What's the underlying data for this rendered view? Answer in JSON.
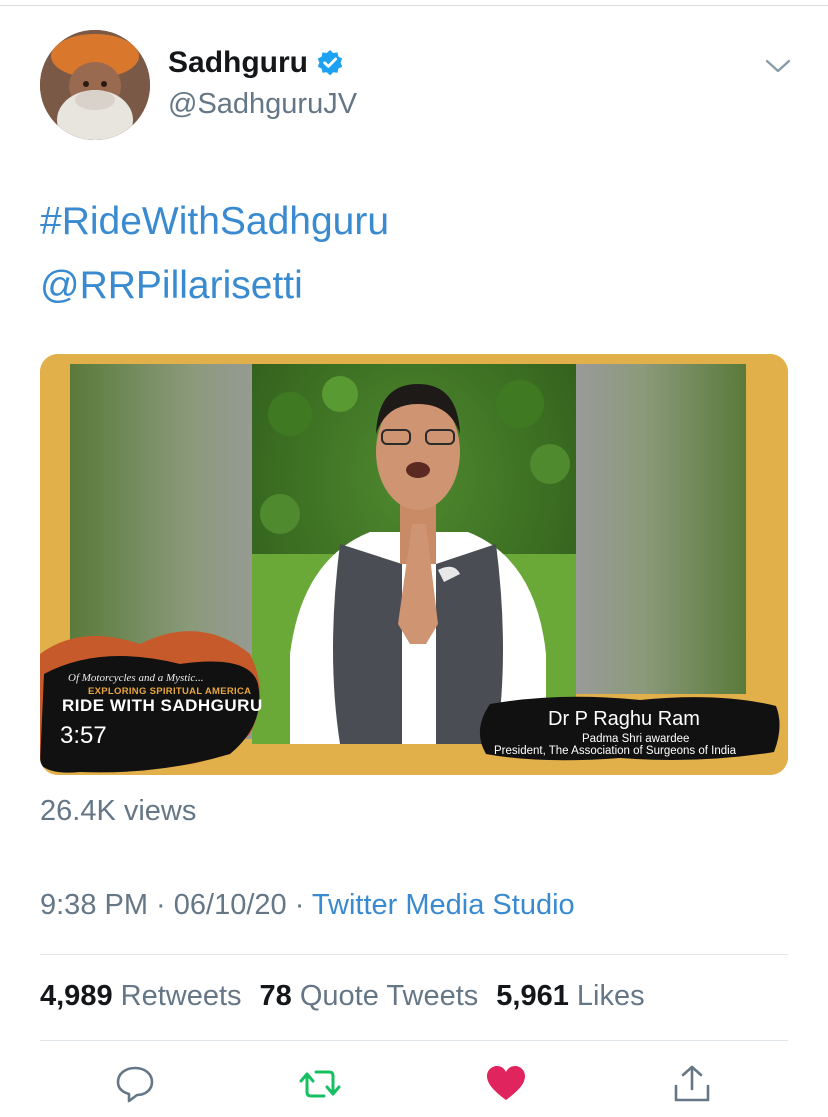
{
  "tweet": {
    "author": {
      "display_name": "Sadhguru",
      "handle": "@SadhguruJV",
      "verified": true
    },
    "text_lines": [
      "#RideWithSadhguru",
      "@RRPillarisetti"
    ],
    "media": {
      "duration": "3:57",
      "overlay_script": "Of Motorcycles and a Mystic...",
      "overlay_subtitle": "EXPLORING SPIRITUAL AMERICA",
      "overlay_title": "RIDE WITH SADHGURU",
      "person_name": "Dr P Raghu Ram",
      "person_award": "Padma Shri awardee",
      "person_title": "President, The Association of Surgeons of India"
    },
    "views": "26.4K views",
    "time": "9:38 PM",
    "separator": " · ",
    "date": "06/10/20",
    "source": "Twitter Media Studio",
    "stats": {
      "retweets_count": "4,989",
      "retweets_label": "Retweets",
      "quote_count": "78",
      "quote_label": "Quote Tweets",
      "likes_count": "5,961",
      "likes_label": "Likes"
    }
  },
  "colors": {
    "link": "#3a8ad0",
    "muted": "#657786",
    "verified": "#1da1f2",
    "retweet": "#17bf63",
    "like": "#e0245e",
    "media_frame": "#e2b04a"
  },
  "icons": [
    "verified-badge-icon",
    "chevron-down-icon",
    "reply-icon",
    "retweet-icon",
    "like-icon",
    "share-icon"
  ]
}
